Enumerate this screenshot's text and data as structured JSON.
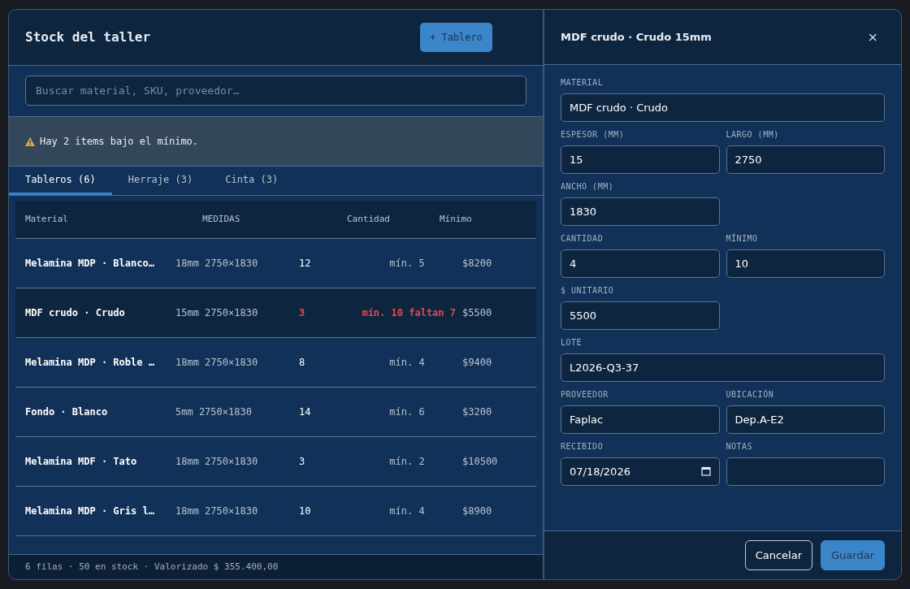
{
  "main": {
    "title": "Stock del taller",
    "add_button": "+ Tablero",
    "search": {
      "placeholder": "Buscar material, SKU, proveedor…"
    },
    "alert": {
      "text": "Hay 2 items bajo el mínimo."
    },
    "tabs": [
      {
        "label": "Tableros (6)",
        "selected": true
      },
      {
        "label": "Herraje (3)",
        "selected": false
      },
      {
        "label": "Cinta (3)",
        "selected": false
      }
    ],
    "table": {
      "columns": [
        "Material",
        "MEDIDAS",
        "Cantidad",
        "Mínimo"
      ],
      "rows": [
        {
          "material": "Melamina MDP · Blanco…",
          "medidas": "18mm 2750×1830",
          "cantidad": "12",
          "minimo": "mín. 5",
          "precio": "$8200",
          "selected": false,
          "low": false
        },
        {
          "material": "MDF crudo · Crudo",
          "medidas": "15mm 2750×1830",
          "cantidad": "3",
          "minimo": "mín. 10 faltan 7",
          "precio": "$5500",
          "selected": true,
          "low": true
        },
        {
          "material": "Melamina MDP · Roble …",
          "medidas": "18mm 2750×1830",
          "cantidad": "8",
          "minimo": "mín. 4",
          "precio": "$9400",
          "selected": false,
          "low": false
        },
        {
          "material": "Fondo · Blanco",
          "medidas": "5mm 2750×1830",
          "cantidad": "14",
          "minimo": "mín. 6",
          "precio": "$3200",
          "selected": false,
          "low": false
        },
        {
          "material": "Melamina MDF · Tato",
          "medidas": "18mm 2750×1830",
          "cantidad": "3",
          "minimo": "mín. 2",
          "precio": "$10500",
          "selected": false,
          "low": false
        },
        {
          "material": "Melamina MDP · Gris l…",
          "medidas": "18mm 2750×1830",
          "cantidad": "10",
          "minimo": "mín. 4",
          "precio": "$8900",
          "selected": false,
          "low": false
        }
      ]
    },
    "footer": "6 filas · 50 en stock · Valorizado $ 355.400,00"
  },
  "panel": {
    "title": "MDF crudo · Crudo 15mm",
    "close": "×",
    "rows": [
      [
        {
          "label": "MATERIAL",
          "value": "MDF crudo · Crudo",
          "kind": "text"
        }
      ],
      [
        {
          "label": "ESPESOR (MM)",
          "value": "15",
          "kind": "text"
        },
        {
          "label": "LARGO (MM)",
          "value": "2750",
          "kind": "text"
        }
      ],
      [
        {
          "label": "ANCHO (MM)",
          "value": "1830",
          "kind": "text"
        }
      ],
      [
        {
          "label": "CANTIDAD",
          "value": "4",
          "kind": "text"
        },
        {
          "label": "MÍNIMO",
          "value": "10",
          "kind": "text"
        }
      ],
      [
        {
          "label": "$ UNITARIO",
          "value": "5500",
          "kind": "text"
        }
      ],
      [
        {
          "label": "LOTE",
          "value": "L2026-Q3-37",
          "kind": "text"
        }
      ],
      [
        {
          "label": "PROVEEDOR",
          "value": "Faplac",
          "kind": "text"
        },
        {
          "label": "UBICACIÓN",
          "value": "Dep.A-E2",
          "kind": "text"
        }
      ],
      [
        {
          "label": "RECIBIDO",
          "value": "07/18/2026",
          "kind": "date"
        },
        {
          "label": "NOTAS",
          "kind": "text"
        }
      ]
    ],
    "buttons": [
      {
        "label": "Cancelar",
        "kind": "secondary"
      },
      {
        "label": "Guardar",
        "kind": "primary"
      }
    ]
  }
}
